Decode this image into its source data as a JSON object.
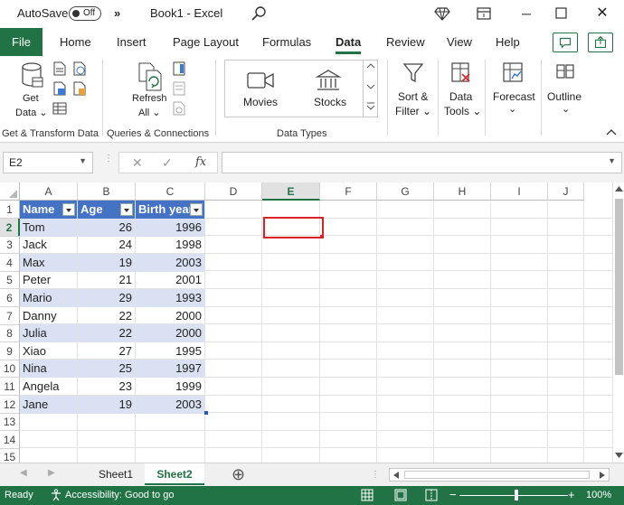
{
  "titlebar": {
    "autosave_label": "AutoSave",
    "autosave_state": "Off",
    "more_label": "»",
    "doc_title": "Book1  -  Excel"
  },
  "tabs": {
    "file": "File",
    "items": [
      "Home",
      "Insert",
      "Page Layout",
      "Formulas",
      "Data",
      "Review",
      "View",
      "Help"
    ],
    "active": "Data"
  },
  "ribbon": {
    "get_data_label_1": "Get",
    "get_data_label_2": "Data ⌄",
    "refresh_label_1": "Refresh",
    "refresh_label_2": "All ⌄",
    "movies_label": "Movies",
    "stocks_label": "Stocks",
    "sort_label_1": "Sort &",
    "sort_label_2": "Filter ⌄",
    "data_tools_label_1": "Data",
    "data_tools_label_2": "Tools ⌄",
    "forecast_label_1": "Forecast",
    "forecast_label_2": "⌄",
    "outline_label_1": "Outline",
    "outline_label_2": "⌄",
    "group_get_transform": "Get & Transform Data",
    "group_queries": "Queries & Connections",
    "group_data_types": "Data Types"
  },
  "formula_bar": {
    "name_box": "E2",
    "fx_label": "fx",
    "formula_value": ""
  },
  "grid": {
    "columns": [
      "A",
      "B",
      "C",
      "D",
      "E",
      "F",
      "G",
      "H",
      "I",
      "J"
    ],
    "rows": [
      "1",
      "2",
      "3",
      "4",
      "5",
      "6",
      "7",
      "8",
      "9",
      "10",
      "11",
      "12",
      "13",
      "14",
      "15"
    ],
    "selected_column": "E",
    "selected_row": "2",
    "table_headers": [
      "Name",
      "Age",
      "Birth year"
    ],
    "table_rows": [
      [
        "Tom",
        "26",
        "1996"
      ],
      [
        "Jack",
        "24",
        "1998"
      ],
      [
        "Max",
        "19",
        "2003"
      ],
      [
        "Peter",
        "21",
        "2001"
      ],
      [
        "Mario",
        "29",
        "1993"
      ],
      [
        "Danny",
        "22",
        "2000"
      ],
      [
        "Julia",
        "22",
        "2000"
      ],
      [
        "Xiao",
        "27",
        "1995"
      ],
      [
        "Nina",
        "25",
        "1997"
      ],
      [
        "Angela",
        "23",
        "1999"
      ],
      [
        "Jane",
        "19",
        "2003"
      ]
    ]
  },
  "sheets": {
    "items": [
      "Sheet1",
      "Sheet2"
    ],
    "active": "Sheet2",
    "add_label": "⊕"
  },
  "status": {
    "ready": "Ready",
    "accessibility": "Accessibility: Good to go",
    "zoom": "100%",
    "minus": "−",
    "plus": "+"
  },
  "colors": {
    "excel_green": "#217346",
    "table_header": "#4472c4",
    "table_band": "#d9e1f2",
    "active_cell_border": "#d8222a"
  }
}
